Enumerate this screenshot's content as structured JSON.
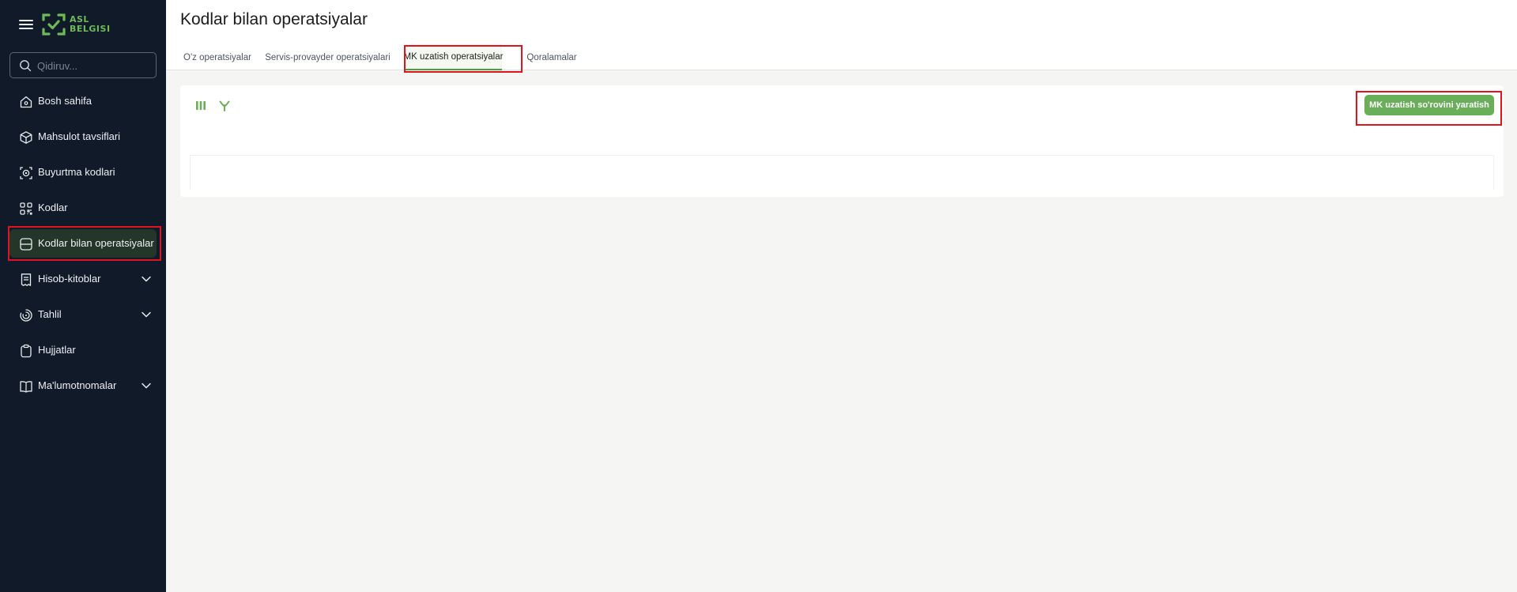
{
  "sidebar": {
    "logo_line1": "ASL",
    "logo_line2": "BELGISI",
    "search_placeholder": "Qidiruv...",
    "items": [
      {
        "label": "Bosh sahifa",
        "icon": "home-icon"
      },
      {
        "label": "Mahsulot tavsiflari",
        "icon": "box-icon"
      },
      {
        "label": "Buyurtma kodlari",
        "icon": "order-codes-icon"
      },
      {
        "label": "Kodlar",
        "icon": "qr-code-icon"
      },
      {
        "label": "Kodlar bilan operatsiyalar",
        "icon": "operations-icon",
        "active": true
      },
      {
        "label": "Hisob-kitoblar",
        "icon": "receipt-icon",
        "expandable": true
      },
      {
        "label": "Tahlil",
        "icon": "analytics-icon",
        "expandable": true
      },
      {
        "label": "Hujjatlar",
        "icon": "clipboard-icon"
      },
      {
        "label": "Ma'lumotnomalar",
        "icon": "book-icon",
        "expandable": true
      }
    ]
  },
  "page": {
    "title": "Kodlar bilan operatsiyalar"
  },
  "tabs": [
    {
      "label": "O'z operatsiyalar"
    },
    {
      "label": "Servis-provayder operatsiyalari"
    },
    {
      "label": "MK uzatish operatsiyalar",
      "active": true
    },
    {
      "label": "Qoralamalar"
    }
  ],
  "toolbar": {
    "columns_icon": "columns-icon",
    "filter_icon": "filter-icon",
    "create_label": "MK uzatish so'rovini yaratish"
  },
  "colors": {
    "sidebar_bg": "#111a28",
    "accent": "#6aae5a",
    "highlight": "#e0141c"
  }
}
